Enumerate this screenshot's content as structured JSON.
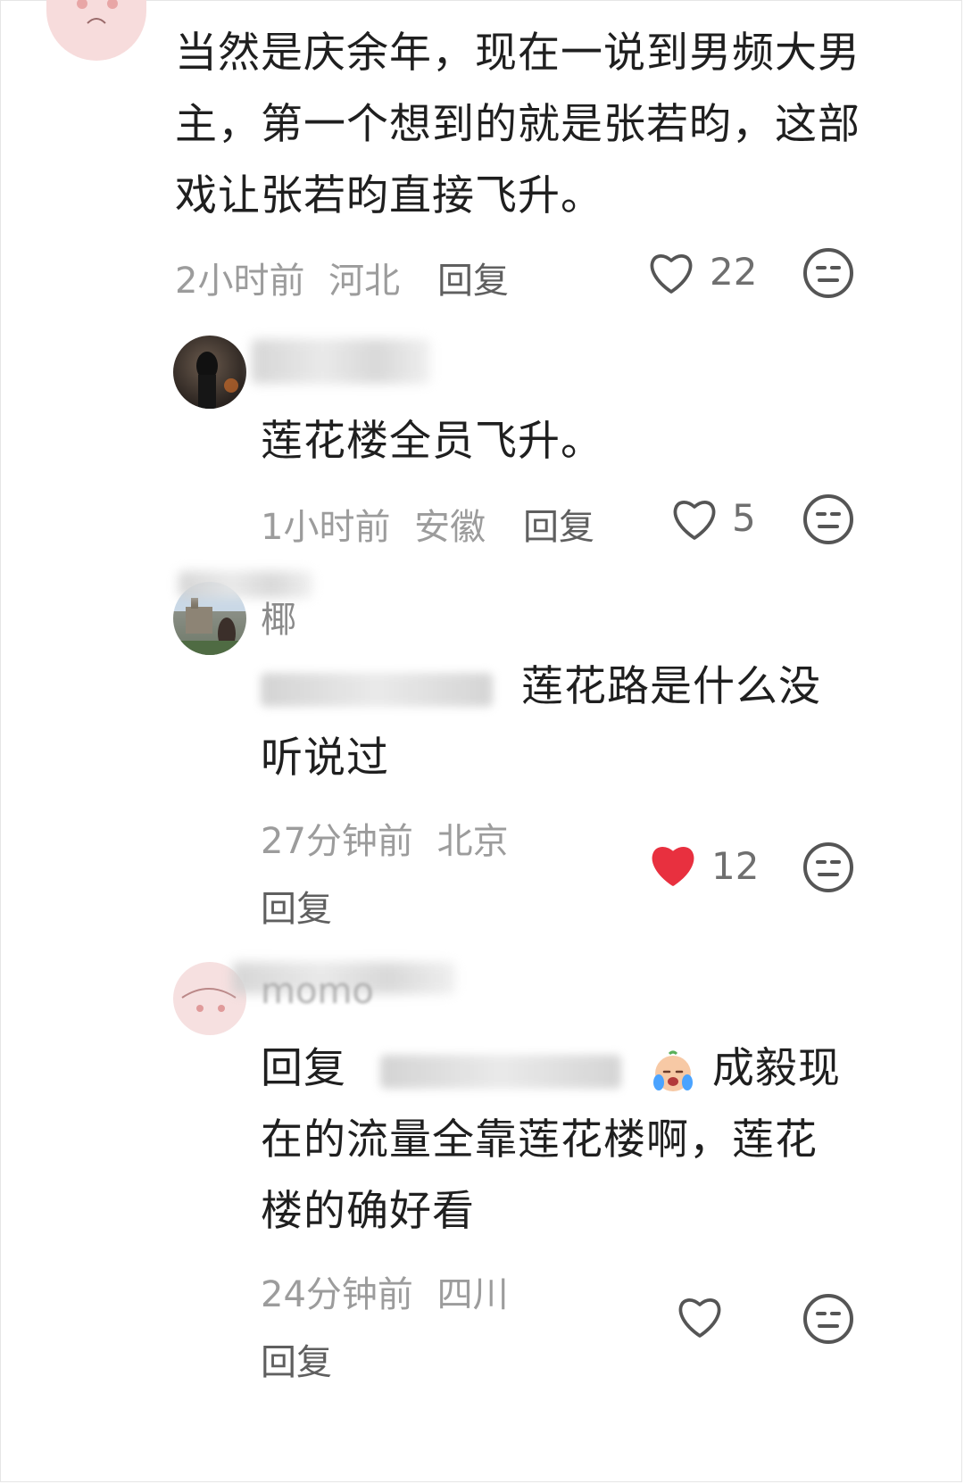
{
  "comments": [
    {
      "text": "当然是庆余年，现在一说到男频大男主，第一个想到的就是张若昀，这部戏让张若昀直接飞升。",
      "time": "2小时前",
      "location": "河北",
      "reply_label": "回复",
      "likes": "22",
      "liked": false
    },
    {
      "text": "莲花楼全员飞升。",
      "time": "1小时前",
      "location": "安徽",
      "reply_label": "回复",
      "likes": "5",
      "liked": false
    },
    {
      "name_visible": "椰",
      "text_line1": "莲花路是什么没",
      "text_line2": "听说过",
      "time": "27分钟前",
      "location": "北京",
      "reply_label": "回复",
      "likes": "12",
      "liked": true
    },
    {
      "name_visible": "momo",
      "reply_prefix": "回复",
      "text_line1": "成毅现",
      "text_line2": "在的流量全靠莲花楼啊，莲花",
      "text_line3": "楼的确好看",
      "time": "24分钟前",
      "location": "四川",
      "reply_label": "回复",
      "likes": "",
      "liked": false
    }
  ],
  "colors": {
    "text": "#1f1f1f",
    "meta": "#9c9c9c",
    "heart_active": "#e8303f",
    "icon": "#555555"
  },
  "icons": {
    "like": "heart-icon",
    "dislike": "neutral-face-icon",
    "emoji": "crying-baby-emoji"
  }
}
